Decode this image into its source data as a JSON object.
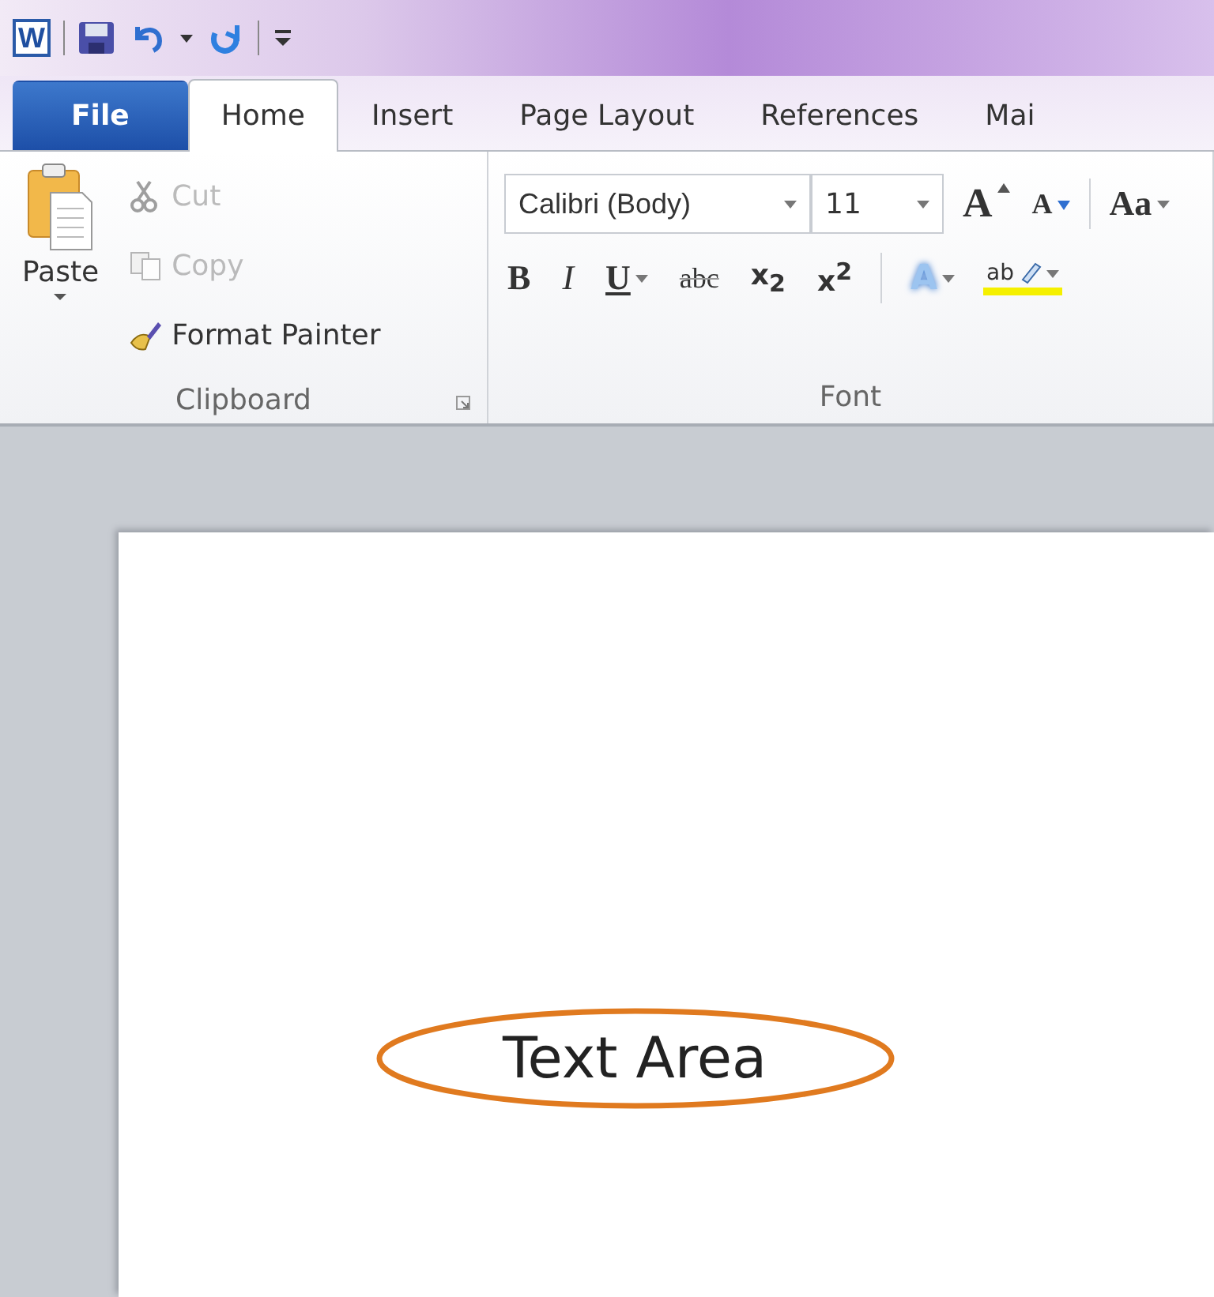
{
  "app_logo": "W",
  "tabs": [
    {
      "label": "File",
      "kind": "file",
      "selected": false
    },
    {
      "label": "Home",
      "kind": "tab",
      "selected": true
    },
    {
      "label": "Insert",
      "kind": "tab",
      "selected": false
    },
    {
      "label": "Page Layout",
      "kind": "tab",
      "selected": false
    },
    {
      "label": "References",
      "kind": "tab",
      "selected": false
    },
    {
      "label": "Mai",
      "kind": "tab",
      "selected": false
    }
  ],
  "clipboard": {
    "paste": "Paste",
    "items": [
      {
        "label": "Cut",
        "kind": "cut",
        "disabled": true
      },
      {
        "label": "Copy",
        "kind": "copy",
        "disabled": true
      },
      {
        "label": "Format Painter",
        "kind": "painter",
        "disabled": false
      }
    ],
    "group_label": "Clipboard"
  },
  "font": {
    "font_name": "Calibri (Body)",
    "font_size": "11",
    "row1": [
      {
        "text": "A",
        "kind": "grow",
        "has_menu": false
      },
      {
        "text": "A",
        "kind": "shrink",
        "has_menu": false
      },
      {
        "text": "Aa",
        "kind": "case",
        "has_menu": true
      }
    ],
    "row2": [
      {
        "text": "B",
        "kind": "bold",
        "has_menu": false
      },
      {
        "text": "I",
        "kind": "italic",
        "has_menu": false
      },
      {
        "text": "U",
        "kind": "underline",
        "has_menu": true
      },
      {
        "text": "abc",
        "kind": "strike",
        "has_menu": false
      },
      {
        "text": "x$_{2}$",
        "kind": "sub",
        "has_menu": false
      },
      {
        "text": "x$^{2}$",
        "kind": "sup",
        "has_menu": false
      },
      {
        "text": "A",
        "kind": "effects",
        "has_menu": true
      },
      {
        "text": "ab",
        "kind": "highlight",
        "has_menu": true
      }
    ],
    "group_label": "Font"
  },
  "document": {
    "text": "Text Area",
    "annotated": true
  }
}
